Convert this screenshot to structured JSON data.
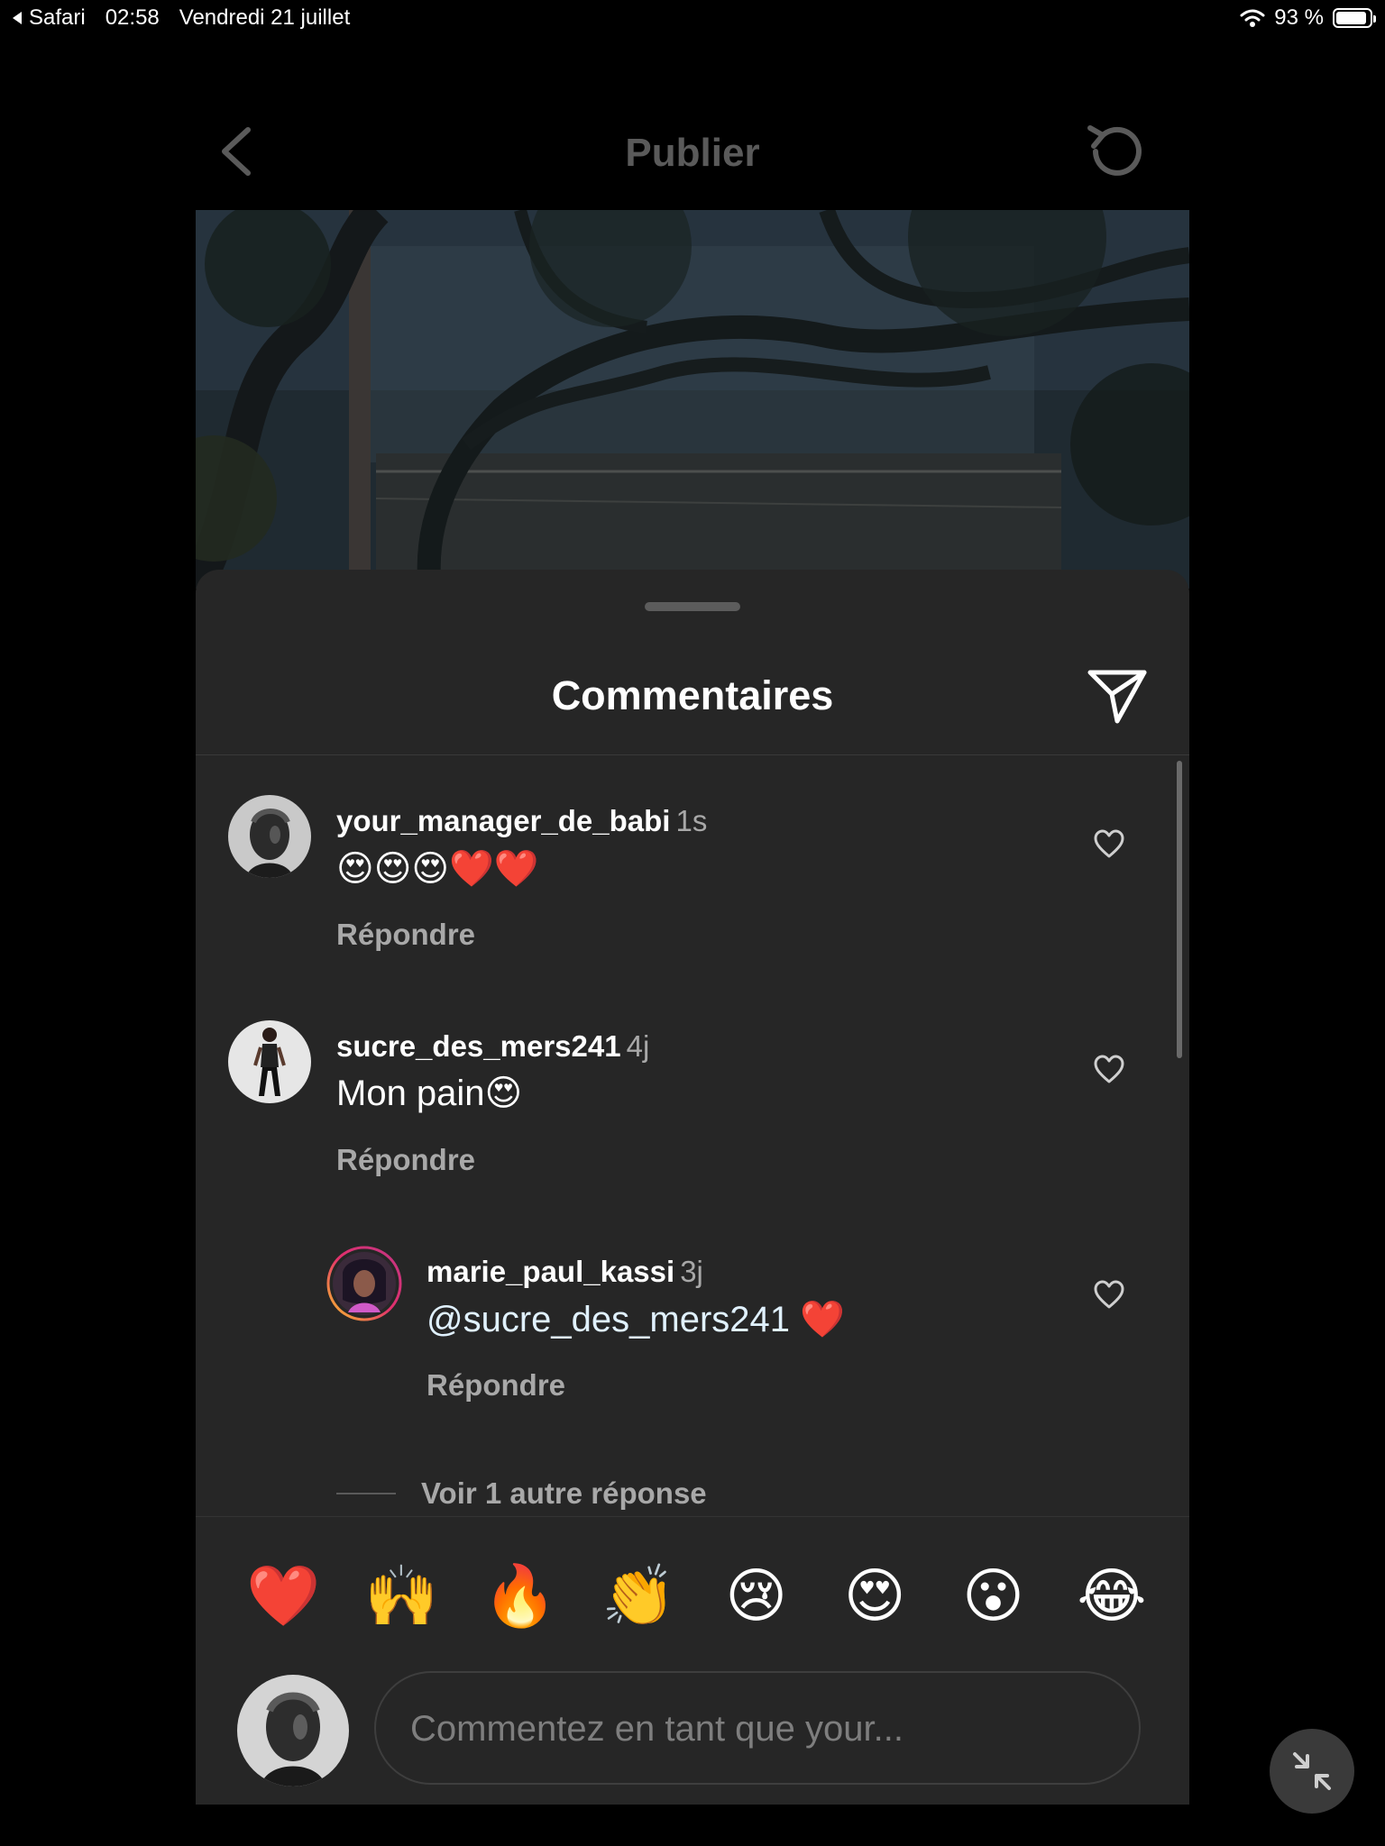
{
  "status_bar": {
    "back_app": "Safari",
    "time": "02:58",
    "date": "Vendredi 21 juillet",
    "battery_percent": "93 %",
    "battery_level": 0.93
  },
  "header": {
    "title": "Publier",
    "back_icon": "chevron-left-icon",
    "refresh_icon": "refresh-icon"
  },
  "sheet": {
    "title": "Commentaires",
    "send_icon": "paper-plane-icon"
  },
  "comments": [
    {
      "username": "your_manager_de_babi",
      "time": "1s",
      "text": "😍😍😍❤️❤️",
      "reply_label": "Répondre"
    },
    {
      "username": "sucre_des_mers241",
      "time": "4j",
      "text": "Mon pain😍",
      "reply_label": "Répondre"
    }
  ],
  "replies": [
    {
      "username": "marie_paul_kassi",
      "time": "3j",
      "mention": "@sucre_des_mers241",
      "text": " ❤️",
      "reply_label": "Répondre"
    }
  ],
  "more_replies_label": "Voir 1 autre réponse",
  "reactions": [
    "❤️",
    "🙌",
    "🔥",
    "👏",
    "😢",
    "😍",
    "😮",
    "😂"
  ],
  "compose": {
    "placeholder": "Commentez en tant que your..."
  },
  "colors": {
    "background": "#000000",
    "sheet": "#262626",
    "secondary_text": "#a8a8a8"
  }
}
